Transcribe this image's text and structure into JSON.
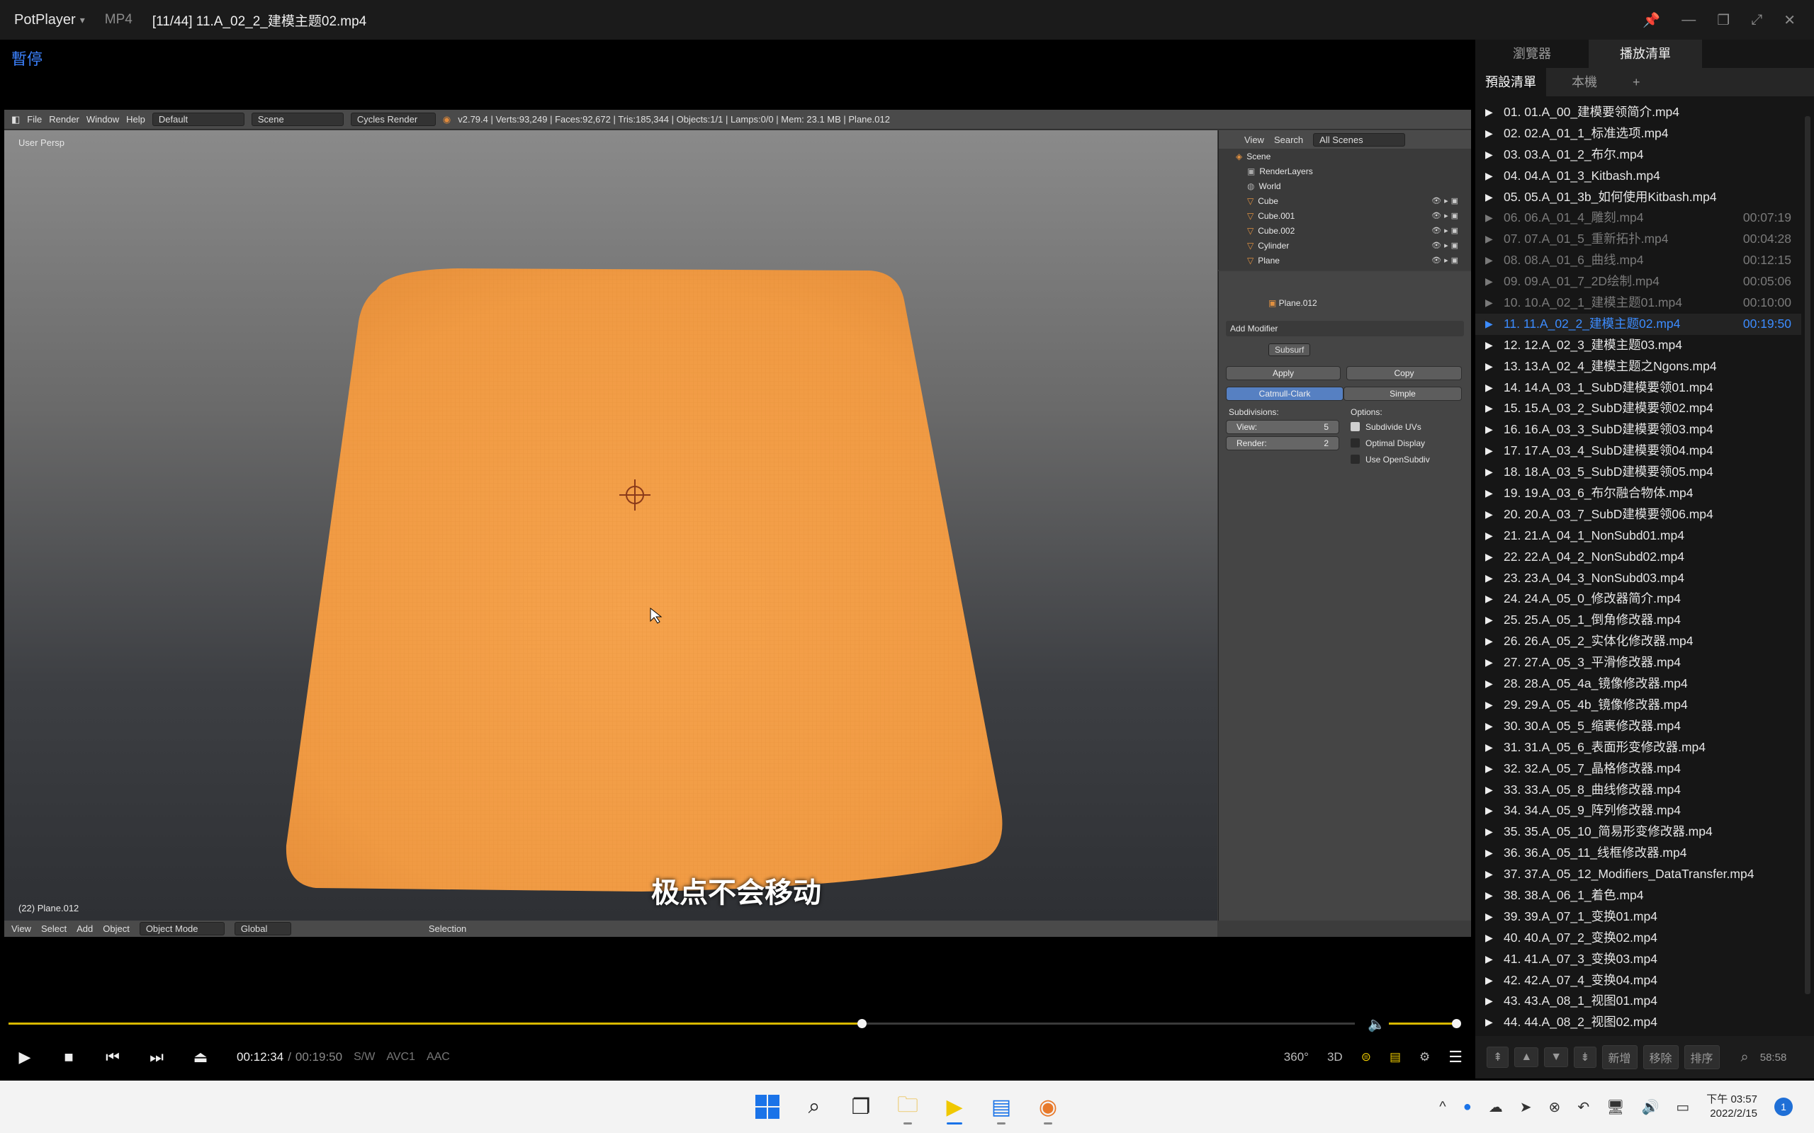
{
  "titlebar": {
    "app_name": "PotPlayer",
    "format": "MP4",
    "file_title": "[11/44] 11.A_02_2_建模主题02.mp4"
  },
  "status": {
    "pause_label": "暫停"
  },
  "blender": {
    "menu": [
      "File",
      "Render",
      "Window",
      "Help"
    ],
    "layout": "Default",
    "scene": "Scene",
    "engine": "Cycles Render",
    "stats": "v2.79.4 | Verts:93,249 | Faces:92,672 | Tris:185,344 | Objects:1/1 | Lamps:0/0 | Mem: 23.1 MB | Plane.012",
    "viewport_label": "User Persp",
    "object_label": "(22) Plane.012",
    "subtitle": "极点不会移动",
    "bottom_menu": [
      "View",
      "Select",
      "Add",
      "Object"
    ],
    "mode": "Object Mode",
    "orientation": "Global",
    "selection": "Selection",
    "outliner": {
      "view": "View",
      "search": "Search",
      "filter": "All Scenes",
      "rows": [
        "Scene",
        "RenderLayers",
        "World",
        "Cube",
        "Cube.001",
        "Cube.002",
        "Cylinder",
        "Plane"
      ]
    },
    "props": {
      "object_name": "Plane.012",
      "add_modifier": "Add Modifier",
      "modifier_name": "Subsurf",
      "apply": "Apply",
      "copy": "Copy",
      "catmull": "Catmull-Clark",
      "simple": "Simple",
      "subdivisions": "Subdivisions:",
      "options": "Options:",
      "view_label": "View:",
      "view_value": "5",
      "render_label": "Render:",
      "render_value": "2",
      "opt1": "Subdivide UVs",
      "opt2": "Optimal Display",
      "opt3": "Use OpenSubdiv"
    }
  },
  "playback": {
    "current_time": "00:12:34",
    "separator": "/",
    "total_time": "00:19:50",
    "sw": "S/W",
    "video_codec": "AVC1",
    "audio_codec": "AAC",
    "progress": 0.6336,
    "volume": 1.0,
    "btn_360": "360°",
    "btn_3d": "3D"
  },
  "panel": {
    "tabs": [
      "瀏覽器",
      "播放清單"
    ],
    "subtabs": [
      "預設清單",
      "本機",
      "+"
    ],
    "items": [
      {
        "name": "01. 01.A_00_建模要领简介.mp4",
        "dur": "",
        "state": ""
      },
      {
        "name": "02. 02.A_01_1_标准选项.mp4",
        "dur": "",
        "state": ""
      },
      {
        "name": "03. 03.A_01_2_布尔.mp4",
        "dur": "",
        "state": ""
      },
      {
        "name": "04. 04.A_01_3_Kitbash.mp4",
        "dur": "",
        "state": ""
      },
      {
        "name": "05. 05.A_01_3b_如何使用Kitbash.mp4",
        "dur": "",
        "state": ""
      },
      {
        "name": "06. 06.A_01_4_雕刻.mp4",
        "dur": "00:07:19",
        "state": "played"
      },
      {
        "name": "07. 07.A_01_5_重新拓扑.mp4",
        "dur": "00:04:28",
        "state": "played"
      },
      {
        "name": "08. 08.A_01_6_曲线.mp4",
        "dur": "00:12:15",
        "state": "played"
      },
      {
        "name": "09. 09.A_01_7_2D绘制.mp4",
        "dur": "00:05:06",
        "state": "played"
      },
      {
        "name": "10. 10.A_02_1_建模主题01.mp4",
        "dur": "00:10:00",
        "state": "played"
      },
      {
        "name": "11. 11.A_02_2_建模主题02.mp4",
        "dur": "00:19:50",
        "state": "current"
      },
      {
        "name": "12. 12.A_02_3_建模主题03.mp4",
        "dur": "",
        "state": ""
      },
      {
        "name": "13. 13.A_02_4_建模主题之Ngons.mp4",
        "dur": "",
        "state": ""
      },
      {
        "name": "14. 14.A_03_1_SubD建模要领01.mp4",
        "dur": "",
        "state": ""
      },
      {
        "name": "15. 15.A_03_2_SubD建模要领02.mp4",
        "dur": "",
        "state": ""
      },
      {
        "name": "16. 16.A_03_3_SubD建模要领03.mp4",
        "dur": "",
        "state": ""
      },
      {
        "name": "17. 17.A_03_4_SubD建模要领04.mp4",
        "dur": "",
        "state": ""
      },
      {
        "name": "18. 18.A_03_5_SubD建模要领05.mp4",
        "dur": "",
        "state": ""
      },
      {
        "name": "19. 19.A_03_6_布尔融合物体.mp4",
        "dur": "",
        "state": ""
      },
      {
        "name": "20. 20.A_03_7_SubD建模要领06.mp4",
        "dur": "",
        "state": ""
      },
      {
        "name": "21. 21.A_04_1_NonSubd01.mp4",
        "dur": "",
        "state": ""
      },
      {
        "name": "22. 22.A_04_2_NonSubd02.mp4",
        "dur": "",
        "state": ""
      },
      {
        "name": "23. 23.A_04_3_NonSubd03.mp4",
        "dur": "",
        "state": ""
      },
      {
        "name": "24. 24.A_05_0_修改器简介.mp4",
        "dur": "",
        "state": ""
      },
      {
        "name": "25. 25.A_05_1_倒角修改器.mp4",
        "dur": "",
        "state": ""
      },
      {
        "name": "26. 26.A_05_2_实体化修改器.mp4",
        "dur": "",
        "state": ""
      },
      {
        "name": "27. 27.A_05_3_平滑修改器.mp4",
        "dur": "",
        "state": ""
      },
      {
        "name": "28. 28.A_05_4a_镜像修改器.mp4",
        "dur": "",
        "state": ""
      },
      {
        "name": "29. 29.A_05_4b_镜像修改器.mp4",
        "dur": "",
        "state": ""
      },
      {
        "name": "30. 30.A_05_5_缩裹修改器.mp4",
        "dur": "",
        "state": ""
      },
      {
        "name": "31. 31.A_05_6_表面形变修改器.mp4",
        "dur": "",
        "state": ""
      },
      {
        "name": "32. 32.A_05_7_晶格修改器.mp4",
        "dur": "",
        "state": ""
      },
      {
        "name": "33. 33.A_05_8_曲线修改器.mp4",
        "dur": "",
        "state": ""
      },
      {
        "name": "34. 34.A_05_9_阵列修改器.mp4",
        "dur": "",
        "state": ""
      },
      {
        "name": "35. 35.A_05_10_简易形变修改器.mp4",
        "dur": "",
        "state": ""
      },
      {
        "name": "36. 36.A_05_11_线框修改器.mp4",
        "dur": "",
        "state": ""
      },
      {
        "name": "37. 37.A_05_12_Modifiers_DataTransfer.mp4",
        "dur": "",
        "state": ""
      },
      {
        "name": "38. 38.A_06_1_着色.mp4",
        "dur": "",
        "state": ""
      },
      {
        "name": "39. 39.A_07_1_变换01.mp4",
        "dur": "",
        "state": ""
      },
      {
        "name": "40. 40.A_07_2_变换02.mp4",
        "dur": "",
        "state": ""
      },
      {
        "name": "41. 41.A_07_3_变换03.mp4",
        "dur": "",
        "state": ""
      },
      {
        "name": "42. 42.A_07_4_变换04.mp4",
        "dur": "",
        "state": ""
      },
      {
        "name": "43. 43.A_08_1_视图01.mp4",
        "dur": "",
        "state": ""
      },
      {
        "name": "44. 44.A_08_2_视图02.mp4",
        "dur": "",
        "state": ""
      }
    ],
    "footer": {
      "new": "新增",
      "remove": "移除",
      "sort": "排序",
      "total": "58:58"
    }
  },
  "taskbar": {
    "time": "下午 03:57",
    "date": "2022/2/15",
    "notifications": "1"
  },
  "colors": {
    "accent_blue": "#3c8cff",
    "seek_yellow": "#d8b800",
    "mesh_orange": "#f5a04a"
  }
}
